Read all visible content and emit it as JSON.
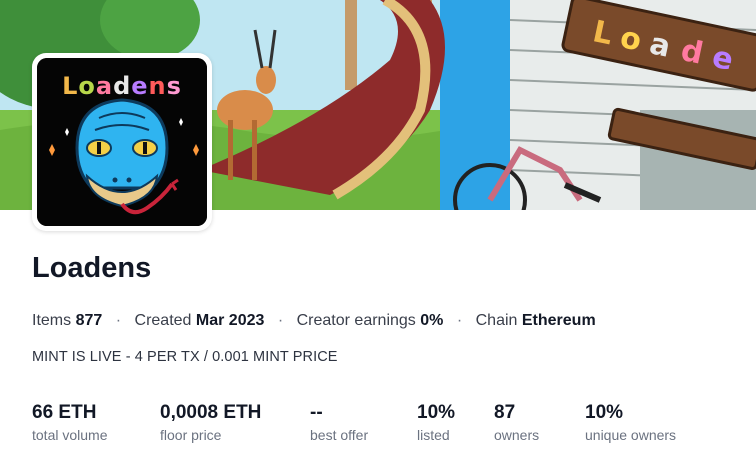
{
  "collection": {
    "name": "Loadens",
    "avatar_text": [
      "L",
      "o",
      "a",
      "d",
      "e",
      "n",
      "s"
    ],
    "banner_sign_text": "Loade",
    "description": "MINT IS LIVE - 4 PER TX / 0.001 MINT PRICE"
  },
  "meta": {
    "items_label": "Items",
    "items_value": "877",
    "created_label": "Created",
    "created_value": "Mar 2023",
    "earnings_label": "Creator earnings",
    "earnings_value": "0%",
    "chain_label": "Chain",
    "chain_value": "Ethereum",
    "separator": "·"
  },
  "stats": [
    {
      "value": "66 ETH",
      "label": "total volume"
    },
    {
      "value": "0,0008 ETH",
      "label": "floor price"
    },
    {
      "value": "--",
      "label": "best offer"
    },
    {
      "value": "10%",
      "label": "listed"
    },
    {
      "value": "87",
      "label": "owners"
    },
    {
      "value": "10%",
      "label": "unique owners"
    }
  ],
  "colors": {
    "text_primary": "#121826",
    "text_secondary": "#6b7280",
    "snake_blue": "#2fb4f0"
  }
}
